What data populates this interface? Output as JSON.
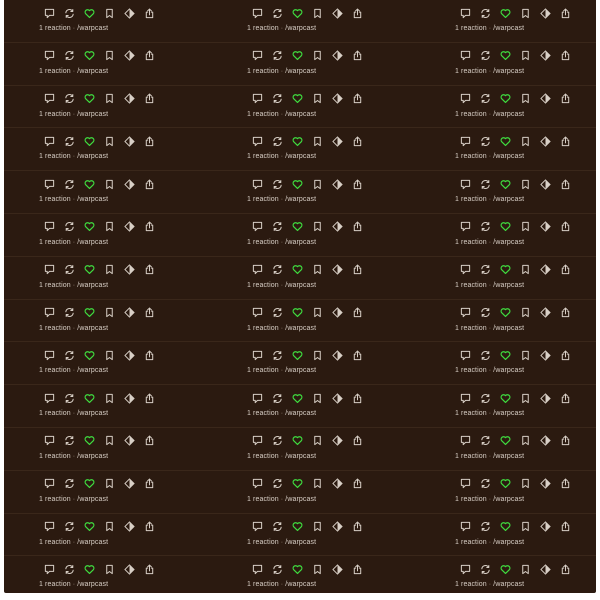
{
  "theme": {
    "bg": "#2b1a10",
    "divider": "#3a271a",
    "text": "#d8cfc6",
    "icon": "#d8cfc6",
    "like": "#3fdc3f"
  },
  "icons": [
    "comment-icon",
    "recast-icon",
    "like-heart-icon",
    "bookmark-icon",
    "tip-icon",
    "share-icon"
  ],
  "casts": [
    [
      {
        "reactions": "1 reaction",
        "sep": "·",
        "channel": "/warpcast"
      },
      {
        "reactions": "1 reaction",
        "sep": "·",
        "channel": "/warpcast"
      },
      {
        "reactions": "1 reaction",
        "sep": "·",
        "channel": "/warpcast"
      }
    ],
    [
      {
        "reactions": "1 reaction",
        "sep": "·",
        "channel": "/warpcast"
      },
      {
        "reactions": "1 reaction",
        "sep": "·",
        "channel": "/warpcast"
      },
      {
        "reactions": "1 reaction",
        "sep": "·",
        "channel": "/warpcast"
      }
    ],
    [
      {
        "reactions": "1 reaction",
        "sep": "·",
        "channel": "/warpcast"
      },
      {
        "reactions": "1 reaction",
        "sep": "·",
        "channel": "/warpcast"
      },
      {
        "reactions": "1 reaction",
        "sep": "·",
        "channel": "/warpcast"
      }
    ],
    [
      {
        "reactions": "1 reaction",
        "sep": "·",
        "channel": "/warpcast"
      },
      {
        "reactions": "1 reaction",
        "sep": "·",
        "channel": "/warpcast"
      },
      {
        "reactions": "1 reaction",
        "sep": "·",
        "channel": "/warpcast"
      }
    ],
    [
      {
        "reactions": "1 reaction",
        "sep": "·",
        "channel": "/warpcast"
      },
      {
        "reactions": "1 reaction",
        "sep": "·",
        "channel": "/warpcast"
      },
      {
        "reactions": "1 reaction",
        "sep": "·",
        "channel": "/warpcast"
      }
    ],
    [
      {
        "reactions": "1 reaction",
        "sep": "·",
        "channel": "/warpcast"
      },
      {
        "reactions": "1 reaction",
        "sep": "·",
        "channel": "/warpcast"
      },
      {
        "reactions": "1 reaction",
        "sep": "·",
        "channel": "/warpcast"
      }
    ],
    [
      {
        "reactions": "1 reaction",
        "sep": "·",
        "channel": "/warpcast"
      },
      {
        "reactions": "1 reaction",
        "sep": "·",
        "channel": "/warpcast"
      },
      {
        "reactions": "1 reaction",
        "sep": "·",
        "channel": "/warpcast"
      }
    ],
    [
      {
        "reactions": "1 reaction",
        "sep": "·",
        "channel": "/warpcast"
      },
      {
        "reactions": "1 reaction",
        "sep": "·",
        "channel": "/warpcast"
      },
      {
        "reactions": "1 reaction",
        "sep": "·",
        "channel": "/warpcast"
      }
    ],
    [
      {
        "reactions": "1 reaction",
        "sep": "·",
        "channel": "/warpcast"
      },
      {
        "reactions": "1 reaction",
        "sep": "·",
        "channel": "/warpcast"
      },
      {
        "reactions": "1 reaction",
        "sep": "·",
        "channel": "/warpcast"
      }
    ],
    [
      {
        "reactions": "1 reaction",
        "sep": "·",
        "channel": "/warpcast"
      },
      {
        "reactions": "1 reaction",
        "sep": "·",
        "channel": "/warpcast"
      },
      {
        "reactions": "1 reaction",
        "sep": "·",
        "channel": "/warpcast"
      }
    ],
    [
      {
        "reactions": "1 reaction",
        "sep": "·",
        "channel": "/warpcast"
      },
      {
        "reactions": "1 reaction",
        "sep": "·",
        "channel": "/warpcast"
      },
      {
        "reactions": "1 reaction",
        "sep": "·",
        "channel": "/warpcast"
      }
    ],
    [
      {
        "reactions": "1 reaction",
        "sep": "·",
        "channel": "/warpcast"
      },
      {
        "reactions": "1 reaction",
        "sep": "·",
        "channel": "/warpcast"
      },
      {
        "reactions": "1 reaction",
        "sep": "·",
        "channel": "/warpcast"
      }
    ],
    [
      {
        "reactions": "1 reaction",
        "sep": "·",
        "channel": "/warpcast"
      },
      {
        "reactions": "1 reaction",
        "sep": "·",
        "channel": "/warpcast"
      },
      {
        "reactions": "1 reaction",
        "sep": "·",
        "channel": "/warpcast"
      }
    ],
    [
      {
        "reactions": "1 reaction",
        "sep": "·",
        "channel": "/warpcast"
      },
      {
        "reactions": "1 reaction",
        "sep": "·",
        "channel": "/warpcast"
      },
      {
        "reactions": "1 reaction",
        "sep": "·",
        "channel": "/warpcast"
      }
    ]
  ]
}
